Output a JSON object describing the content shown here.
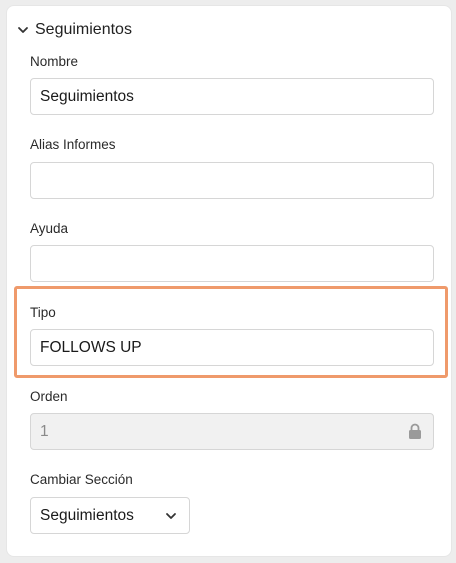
{
  "section": {
    "title": "Seguimientos",
    "expanded": true
  },
  "fields": {
    "nombre": {
      "label": "Nombre",
      "value": "Seguimientos"
    },
    "alias": {
      "label": "Alias Informes",
      "value": ""
    },
    "ayuda": {
      "label": "Ayuda",
      "value": ""
    },
    "tipo": {
      "label": "Tipo",
      "value": "FOLLOWS UP"
    },
    "orden": {
      "label": "Orden",
      "value": "1",
      "locked": true
    },
    "cambiar_seccion": {
      "label": "Cambiar Sección",
      "selected": "Seguimientos"
    }
  },
  "colors": {
    "highlight": "#ef9a6b",
    "disabled_bg": "#f1f1f1"
  }
}
